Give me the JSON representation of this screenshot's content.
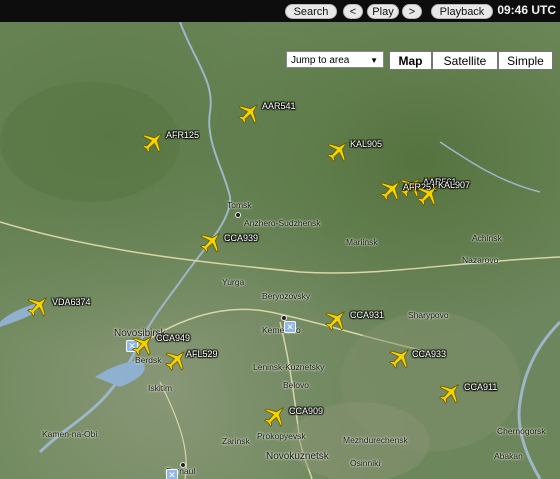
{
  "toolbar": {
    "search_label": "Search",
    "prev_label": "<",
    "play_label": "Play",
    "next_label": ">",
    "playback_label": "Playback",
    "clock": "09:46 UTC"
  },
  "map_controls": {
    "jump_to_area": "Jump to area",
    "map_types": [
      "Map",
      "Satellite",
      "Simple"
    ],
    "selected_map_type": "Map"
  },
  "cities": [
    "Tomsk",
    "Anzhero-Sudzhensk",
    "Mariinsk",
    "Achinsk",
    "Nazarovo",
    "Yurga",
    "Beryozovsky",
    "Kemerovo",
    "Sharypovo",
    "Novosibirsk",
    "Berdsk",
    "Leninsk-Kuznetsky",
    "Belovo",
    "Iskitim",
    "Kamen-na-Obi",
    "Zarinsk",
    "Prokopyevsk",
    "Mezhdurechensk",
    "Novokuznetsk",
    "Osinniki",
    "Chernogorsk",
    "Abakan",
    "Barnaul"
  ],
  "flights": [
    "AAR541",
    "AFR125",
    "KAL905",
    "AAR561",
    "AFR251",
    "KAL907",
    "CCA939",
    "VDA6374",
    "CCA949",
    "AFL529",
    "CCA931",
    "CCA933",
    "CCA911",
    "CCA909"
  ],
  "colors": {
    "plane": "#f5d400",
    "topbar": "#0d0d0d",
    "map_green": "#6c8759"
  }
}
